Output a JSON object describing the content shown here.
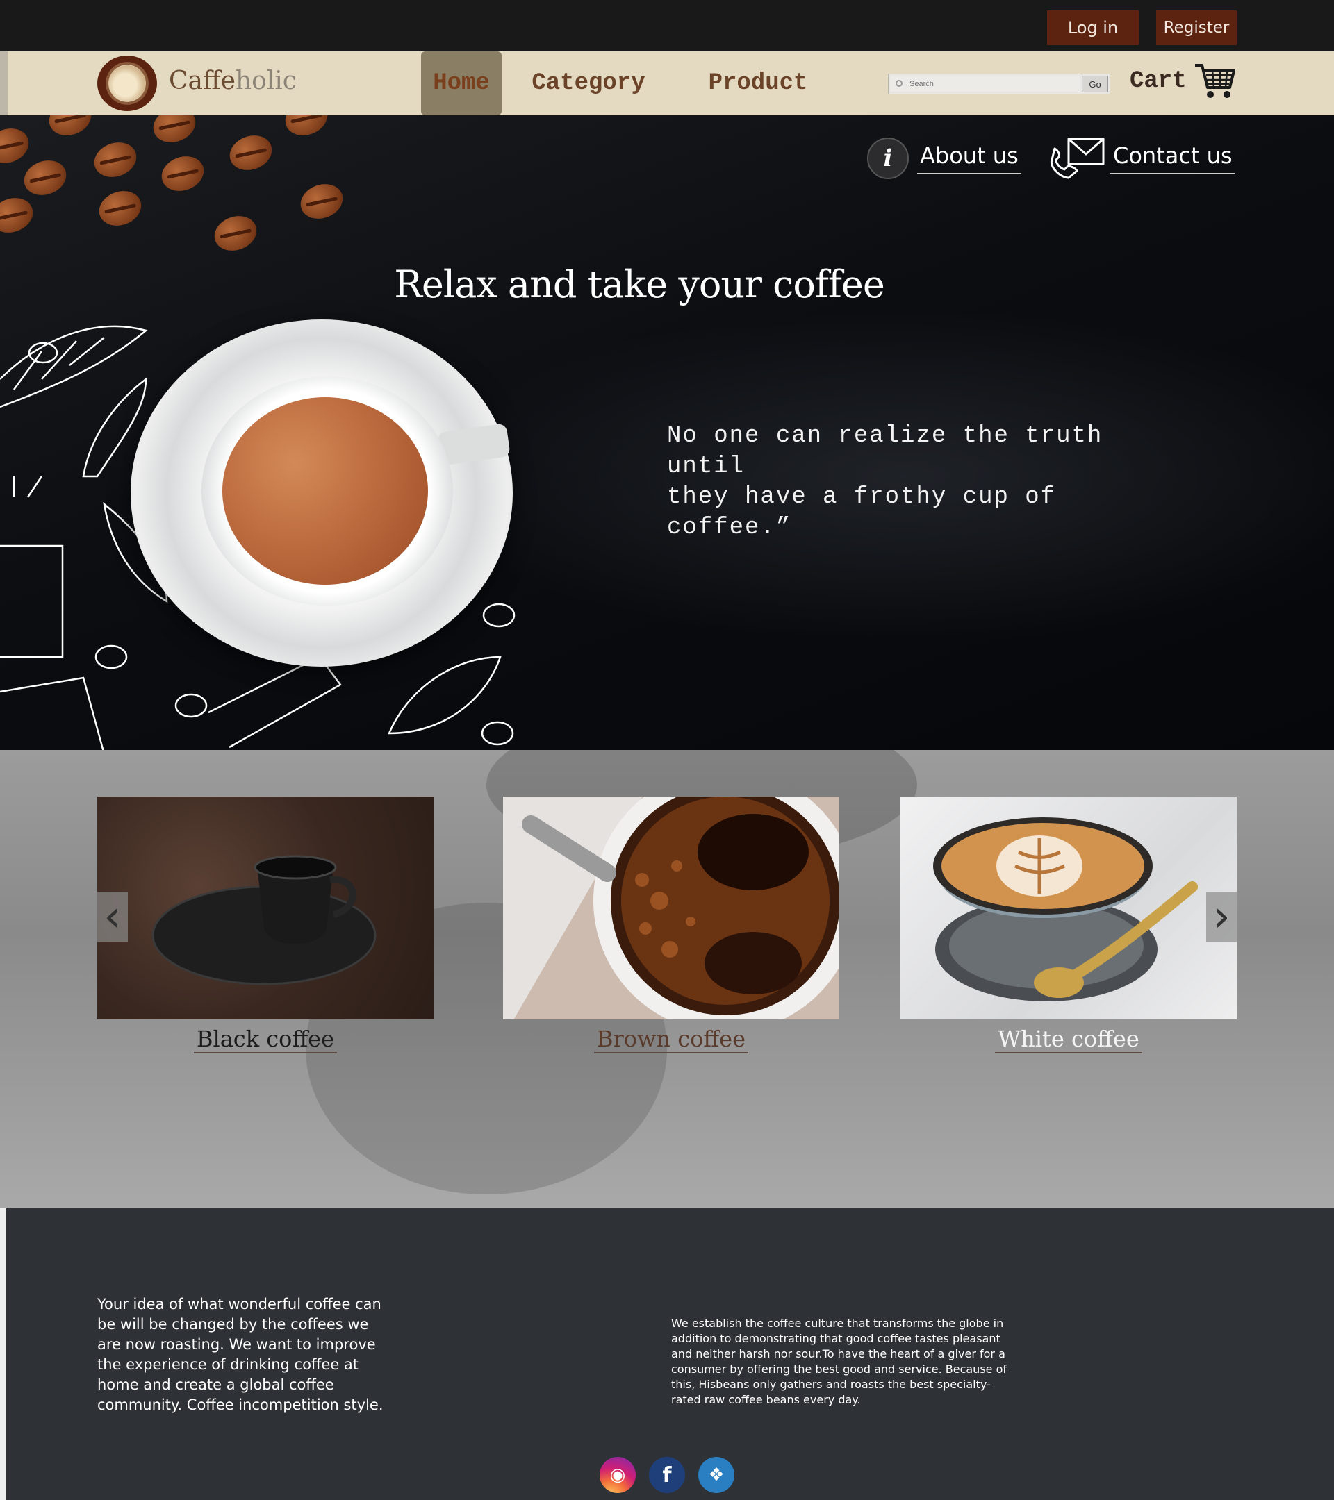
{
  "auth": {
    "login_label": "Log in",
    "register_label": "Register"
  },
  "brand": {
    "part1": "Caffe",
    "part2": "holic",
    "logo_text": "Caffeholic"
  },
  "nav": {
    "items": [
      {
        "label": "Home",
        "active": true
      },
      {
        "label": "Category",
        "active": false
      },
      {
        "label": "Product",
        "active": false
      }
    ],
    "search_placeholder": "Search",
    "go_label": "Go",
    "cart_label": "Cart"
  },
  "hero": {
    "about_label": "About us",
    "contact_label": "Contact us",
    "title": "Relax and take your coffee",
    "quote_line1": "No one can realize the truth until",
    "quote_line2": "they have a frothy cup of coffee.”"
  },
  "products": [
    {
      "label": "Black coffee",
      "color": "#1c1c1c"
    },
    {
      "label": "Brown coffee",
      "color": "#5a3a2a"
    },
    {
      "label": "White coffee",
      "color": "#f4f4f4"
    }
  ],
  "carousel": {
    "prev_icon": "chevron-left-icon",
    "next_icon": "chevron-right-icon"
  },
  "footer": {
    "left_text": "Your idea of what wonderful coffee can be will be changed by the coffees we are now roasting. We want to improve the experience of drinking coffee at home and create a global coffee community. Coffee incompetition style.",
    "right_text": "We establish the coffee culture that transforms the globe in addition to demonstrating that good coffee tastes pleasant and neither harsh nor sour.To have the heart of a giver for a consumer by offering the best good and service. Because of this, Hisbeans only gathers and roasts the best specialty-rated raw coffee beans every day.",
    "social": [
      "instagram-icon",
      "facebook-icon",
      "twitter-icon"
    ]
  },
  "colors": {
    "accent": "#5c2410",
    "nav_bg": "#e4dac1",
    "active_tab": "#8a7f64",
    "footer_bg": "#2e3135"
  }
}
